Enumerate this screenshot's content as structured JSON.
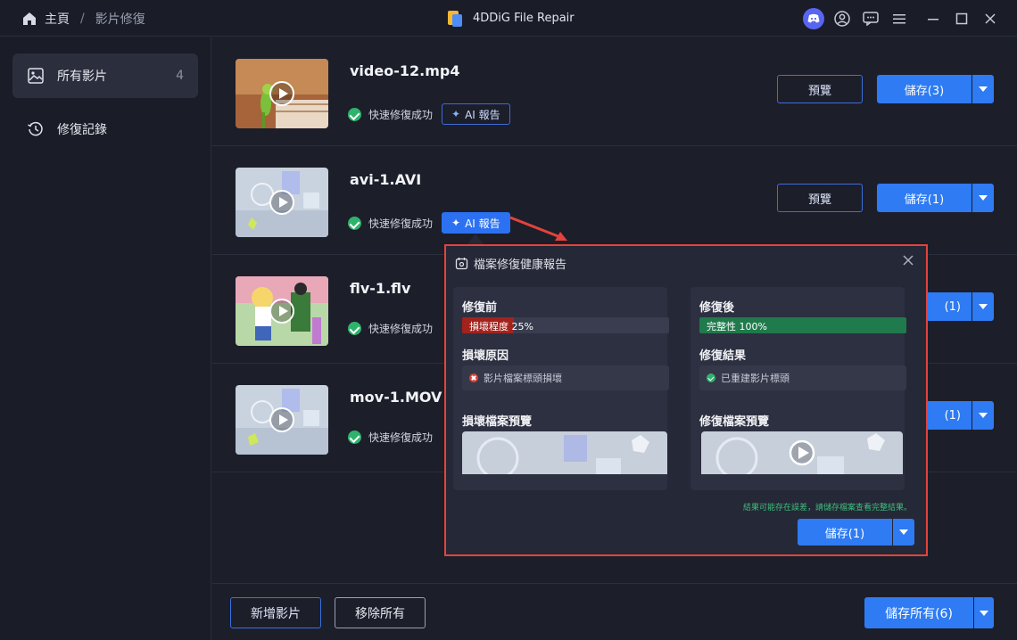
{
  "titlebar": {
    "home_label": "主頁",
    "separator": "/",
    "page_label": "影片修復",
    "app_title": "4DDiG File Repair"
  },
  "sidebar": {
    "items": [
      {
        "label": "所有影片",
        "count": "4"
      },
      {
        "label": "修復記錄"
      }
    ]
  },
  "files": [
    {
      "name": "video-12.mp4",
      "status": "快速修復成功",
      "ai_label": "AI 報告",
      "preview_label": "預覽",
      "save_label": "儲存(3)",
      "thumb": "parrot"
    },
    {
      "name": "avi-1.AVI",
      "status": "快速修復成功",
      "ai_label": "AI 報告",
      "preview_label": "預覽",
      "save_label": "儲存(1)",
      "thumb": "abstract"
    },
    {
      "name": "flv-1.flv",
      "status": "快速修復成功",
      "save_label": "(1)",
      "thumb": "anime"
    },
    {
      "name": "mov-1.MOV",
      "status": "快速修復成功",
      "save_label": "(1)",
      "thumb": "abstract"
    }
  ],
  "report": {
    "title": "檔案修復健康報告",
    "before": {
      "title": "修復前",
      "bar_text": "損壞程度 25%",
      "damage_fraction": 0.25,
      "reason_title": "損壞原因",
      "reason": "影片檔案標頭損壞",
      "preview_title": "損壞檔案預覽"
    },
    "after": {
      "title": "修復後",
      "bar_text": "完整性 100%",
      "integrity_fraction": 1.0,
      "result_title": "修復結果",
      "result": "已重建影片標頭",
      "preview_title": "修復檔案預覽"
    },
    "note": "結果可能存在誤差，請儲存檔案查看完整結果。",
    "save_label": "儲存(1)"
  },
  "footer": {
    "add_label": "新增影片",
    "remove_label": "移除所有",
    "save_all_label": "儲存所有(6)"
  },
  "colors": {
    "accent": "#2e7bf3",
    "success": "#2fb36c",
    "damage": "#a3231c",
    "integrity": "#1f7a4c",
    "highlight": "#e3433b"
  }
}
